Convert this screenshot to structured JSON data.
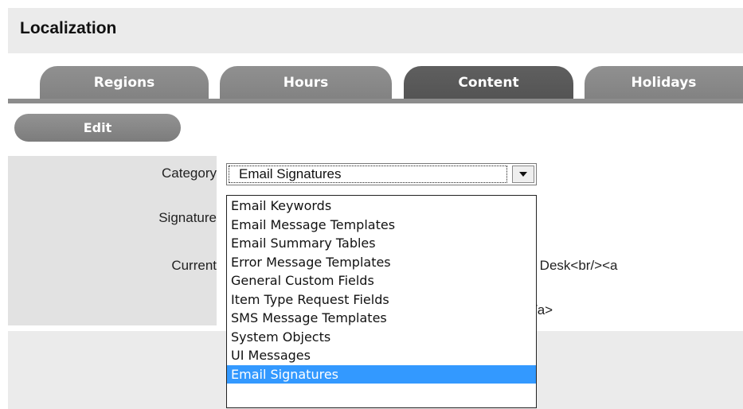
{
  "header": {
    "title": "Localization"
  },
  "tabs": [
    {
      "label": "Regions",
      "active": false
    },
    {
      "label": "Hours",
      "active": false
    },
    {
      "label": "Content",
      "active": true
    },
    {
      "label": "Holidays",
      "active": false
    }
  ],
  "toolbar": {
    "edit_label": "Edit"
  },
  "form": {
    "category_label": "Category",
    "signature_label": "Signature",
    "current_label": "Current",
    "category_value": "Email Signatures",
    "current_value_line1": "ce Desk<br/><a",
    "current_value_line2": "/a>"
  },
  "dropdown": {
    "options": [
      "Email Keywords",
      "Email Message Templates",
      "Email Summary Tables",
      "Error Message Templates",
      "General Custom Fields",
      "Item Type Request Fields",
      "SMS Message Templates",
      "System Objects",
      "UI Messages",
      "Email Signatures"
    ],
    "selected": "Email Signatures"
  },
  "colors": {
    "tab": "#8a8a8a",
    "tab_active": "#5a5a5a",
    "highlight": "#3399ff"
  }
}
